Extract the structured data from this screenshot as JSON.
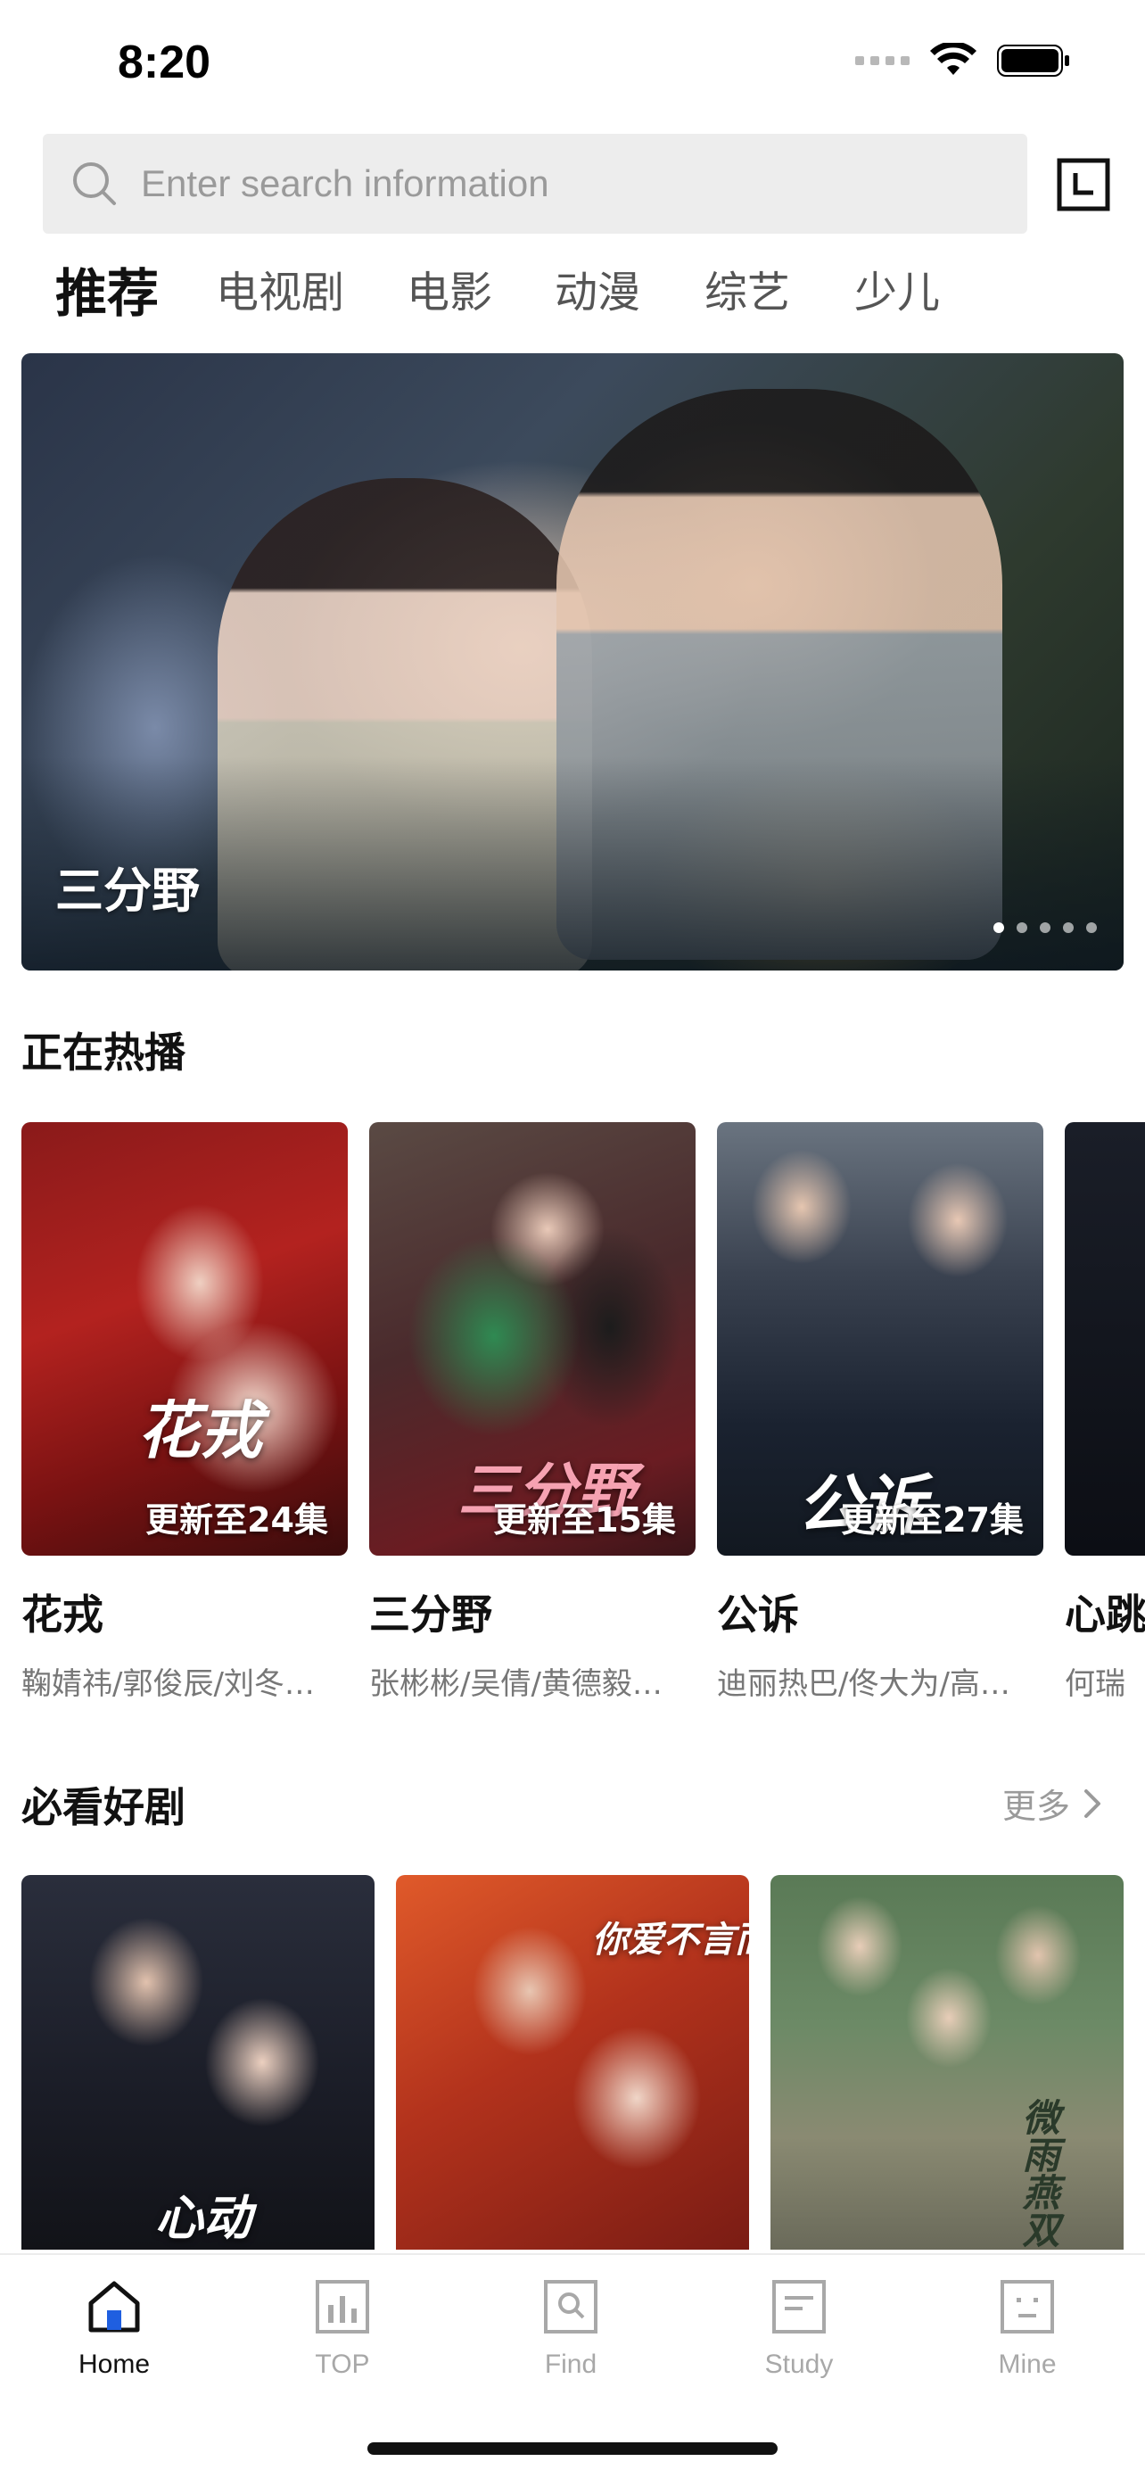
{
  "status_bar": {
    "time": "8:20"
  },
  "search": {
    "placeholder": "Enter search information"
  },
  "category_tabs": [
    {
      "label": "推荐",
      "active": true
    },
    {
      "label": "电视剧",
      "active": false
    },
    {
      "label": "电影",
      "active": false
    },
    {
      "label": "动漫",
      "active": false
    },
    {
      "label": "综艺",
      "active": false
    },
    {
      "label": "少儿",
      "active": false
    }
  ],
  "banner": {
    "title": "三分野",
    "dot_count": 5,
    "active_dot": 1
  },
  "now_playing": {
    "title": "正在热播",
    "items": [
      {
        "title": "花戎",
        "badge": "更新至24集",
        "cast": "鞠婧祎/郭俊辰/刘冬…",
        "poster_text": "花戎"
      },
      {
        "title": "三分野",
        "badge": "更新至15集",
        "cast": "张彬彬/吴倩/黄德毅…",
        "poster_text": "三分野"
      },
      {
        "title": "公诉",
        "badge": "更新至27集",
        "cast": "迪丽热巴/佟大为/高…",
        "poster_text": "公诉"
      },
      {
        "title": "心跳",
        "badge": "",
        "cast": "何瑞",
        "poster_text": ""
      }
    ]
  },
  "must_watch": {
    "title": "必看好剧",
    "more_label": "更多",
    "items": [
      {
        "poster_text": "心动"
      },
      {
        "poster_text": "你爱不言而喻"
      },
      {
        "poster_text": "微雨燕双飞"
      }
    ]
  },
  "tab_bar": {
    "items": [
      {
        "label": "Home",
        "icon": "home-icon",
        "active": true
      },
      {
        "label": "TOP",
        "icon": "chart-icon",
        "active": false
      },
      {
        "label": "Find",
        "icon": "find-icon",
        "active": false
      },
      {
        "label": "Study",
        "icon": "study-icon",
        "active": false
      },
      {
        "label": "Mine",
        "icon": "mine-icon",
        "active": false
      }
    ]
  },
  "colors": {
    "accent": "#1f5fe0",
    "text": "#111111",
    "muted": "#a8a8a8",
    "search_bg": "#ededed"
  }
}
